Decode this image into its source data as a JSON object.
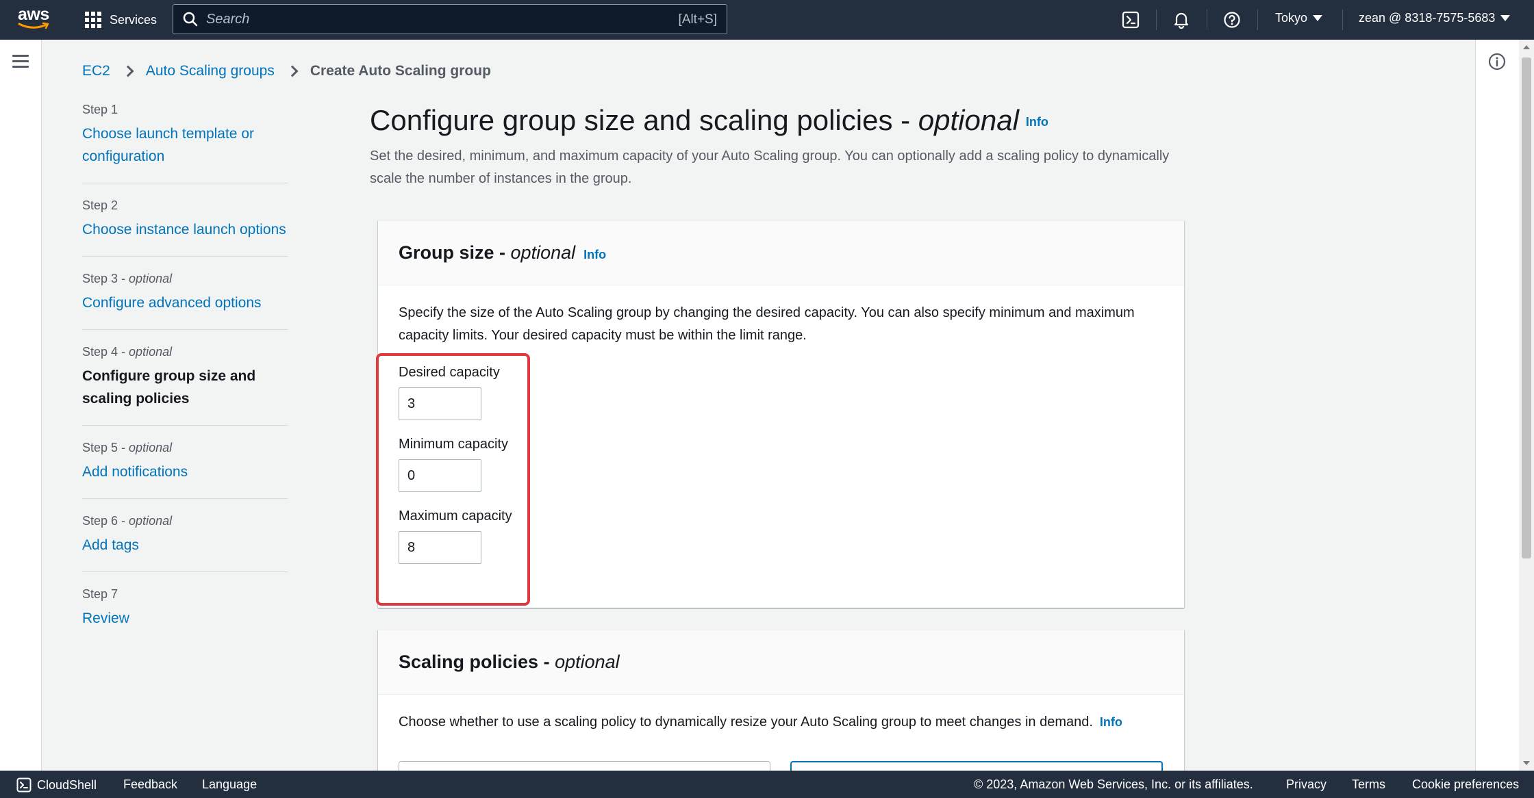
{
  "topnav": {
    "logo_text": "aws",
    "services_label": "Services",
    "search_placeholder": "Search",
    "search_shortcut": "[Alt+S]",
    "region": "Tokyo",
    "account": "zean @ 8318-7575-5683"
  },
  "breadcrumb": {
    "items": [
      "EC2",
      "Auto Scaling groups"
    ],
    "current": "Create Auto Scaling group"
  },
  "steps": [
    {
      "num": "Step 1",
      "optional": "",
      "label": "Choose launch template or configuration"
    },
    {
      "num": "Step 2",
      "optional": "",
      "label": "Choose instance launch options"
    },
    {
      "num": "Step 3",
      "optional": "optional",
      "label": "Configure advanced options"
    },
    {
      "num": "Step 4",
      "optional": "optional",
      "label": "Configure group size and scaling policies"
    },
    {
      "num": "Step 5",
      "optional": "optional",
      "label": "Add notifications"
    },
    {
      "num": "Step 6",
      "optional": "optional",
      "label": "Add tags"
    },
    {
      "num": "Step 7",
      "optional": "",
      "label": "Review"
    }
  ],
  "page": {
    "title_main": "Configure group size and scaling policies - ",
    "title_optional": "optional",
    "info": "Info",
    "description": "Set the desired, minimum, and maximum capacity of your Auto Scaling group. You can optionally add a scaling policy to dynamically scale the number of instances in the group."
  },
  "group_size": {
    "title": "Group size - ",
    "title_optional": "optional",
    "info": "Info",
    "description": "Specify the size of the Auto Scaling group by changing the desired capacity. You can also specify minimum and maximum capacity limits. Your desired capacity must be within the limit range.",
    "desired_label": "Desired capacity",
    "desired_value": "3",
    "minimum_label": "Minimum capacity",
    "minimum_value": "0",
    "maximum_label": "Maximum capacity",
    "maximum_value": "8"
  },
  "scaling_policies": {
    "title": "Scaling policies - ",
    "title_optional": "optional",
    "description": "Choose whether to use a scaling policy to dynamically resize your Auto Scaling group to meet changes in demand.",
    "info": "Info"
  },
  "footer": {
    "cloudshell": "CloudShell",
    "feedback": "Feedback",
    "language": "Language",
    "copyright": "© 2023, Amazon Web Services, Inc. or its affiliates.",
    "privacy": "Privacy",
    "terms": "Terms",
    "cookie": "Cookie preferences"
  },
  "colors": {
    "nav_bg": "#232f3e",
    "link": "#0073bb",
    "highlight": "#e0383e"
  }
}
